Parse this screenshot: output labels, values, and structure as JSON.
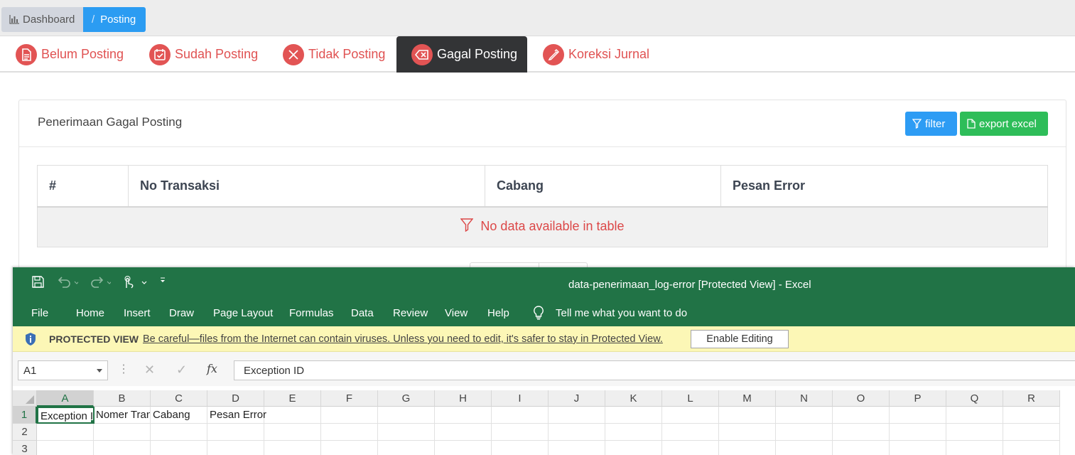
{
  "breadcrumb": {
    "dashboard": "Dashboard",
    "separator": "/",
    "current": "Posting"
  },
  "tabs": [
    {
      "label": "Belum Posting",
      "icon": "document-icon"
    },
    {
      "label": "Sudah Posting",
      "icon": "calendar-check-icon"
    },
    {
      "label": "Tidak Posting",
      "icon": "close-icon"
    },
    {
      "label": "Gagal Posting",
      "icon": "backspace-x-icon",
      "active": true
    },
    {
      "label": "Koreksi Jurnal",
      "icon": "pen-icon"
    }
  ],
  "panel": {
    "title": "Penerimaan Gagal Posting",
    "filter_label": "filter",
    "export_label": "export excel"
  },
  "table": {
    "columns": [
      "#",
      "No Transaksi",
      "Cabang",
      "Pesan Error"
    ],
    "empty_message": "No data available in table"
  },
  "excel": {
    "window_title": "data-penerimaan_log-error  [Protected View]  -  Excel",
    "menu": [
      "File",
      "Home",
      "Insert",
      "Draw",
      "Page Layout",
      "Formulas",
      "Data",
      "Review",
      "View",
      "Help"
    ],
    "tell_me": "Tell me what you want to do",
    "protected_label": "PROTECTED VIEW",
    "protected_message": "Be careful—files from the Internet can contain viruses. Unless you need to edit, it's safer to stay in Protected View.",
    "enable_editing": "Enable Editing",
    "name_box": "A1",
    "formula_value": "Exception ID",
    "fx_label": "fx",
    "columns": [
      "A",
      "B",
      "C",
      "D",
      "E",
      "F",
      "G",
      "H",
      "I",
      "J",
      "K",
      "L",
      "M",
      "N",
      "O",
      "P",
      "Q",
      "R"
    ],
    "rows": [
      "1",
      "2",
      "3"
    ],
    "row1_cells": [
      "Exception ID",
      "Nomer Transaksi",
      "Cabang",
      "Pesan Error"
    ]
  },
  "colors": {
    "accent_blue": "#2d9cf4",
    "accent_green": "#2ebd59",
    "tab_red": "#e05252",
    "excel_green": "#217346"
  }
}
